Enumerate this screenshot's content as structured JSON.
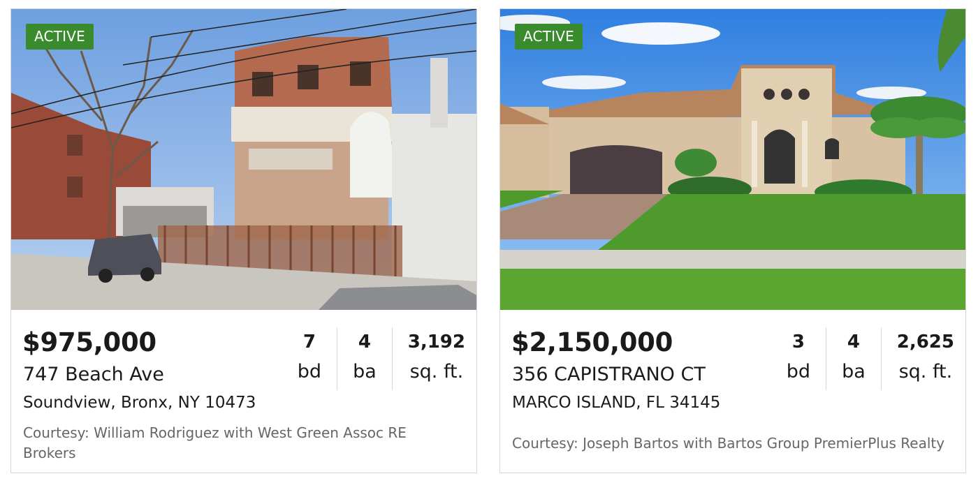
{
  "listings": [
    {
      "status": "ACTIVE",
      "price": "$975,000",
      "address": "747 Beach Ave",
      "city": "Soundview, Bronx, NY 10473",
      "beds": "7",
      "beds_label": "bd",
      "baths": "4",
      "baths_label": "ba",
      "sqft": "3,192",
      "sqft_label": "sq. ft.",
      "courtesy": "Courtesy: William Rodriguez with West Green Assoc RE Brokers"
    },
    {
      "status": "ACTIVE",
      "price": "$2,150,000",
      "address": "356 CAPISTRANO CT",
      "city": "MARCO ISLAND, FL 34145",
      "beds": "3",
      "beds_label": "bd",
      "baths": "4",
      "baths_label": "ba",
      "sqft": "2,625",
      "sqft_label": "sq. ft.",
      "courtesy": "Courtesy: Joseph Bartos with Bartos Group PremierPlus Realty"
    }
  ],
  "colors": {
    "badge": "#3a8a2e",
    "courtesy_text": "#666666",
    "card_border": "#d6d6d6"
  }
}
